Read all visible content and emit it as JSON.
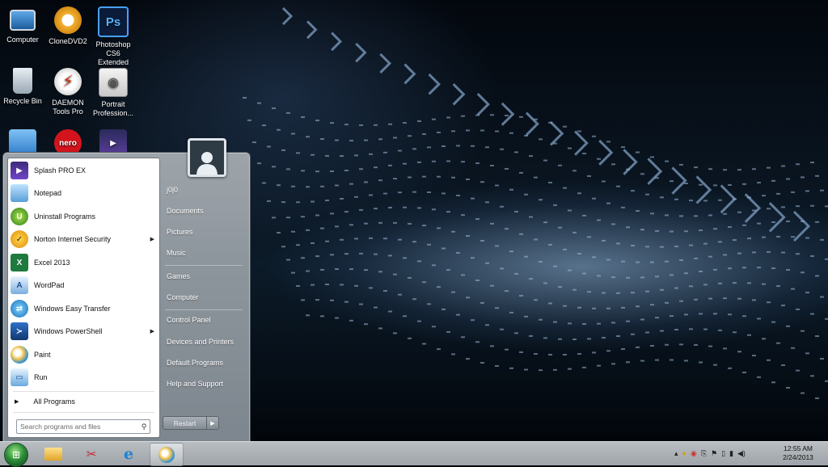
{
  "desktop": {
    "icons": [
      {
        "label": "Computer",
        "icon": "computer-icon"
      },
      {
        "label": "CloneDVD2",
        "icon": "clonedvd-sheep-icon"
      },
      {
        "label": "Photoshop CS6 Extended",
        "icon": "photoshop-icon",
        "glyph": "Ps"
      },
      {
        "label": "Recycle Bin",
        "icon": "recycle-bin-icon"
      },
      {
        "label": "DAEMON Tools Pro",
        "icon": "daemon-tools-icon"
      },
      {
        "label": "Portrait Profession...",
        "icon": "camera-icon"
      },
      {
        "label": "",
        "icon": "app-icon"
      },
      {
        "label": "",
        "icon": "nero-icon",
        "glyph": "nero"
      },
      {
        "label": "",
        "icon": "clapper-icon"
      }
    ]
  },
  "start_menu": {
    "programs": [
      {
        "label": "Splash PRO EX",
        "icon": "splash-pro-icon",
        "has_arrow": false
      },
      {
        "label": "Notepad",
        "icon": "notepad-icon",
        "has_arrow": false
      },
      {
        "label": "Uninstall Programs",
        "icon": "uninstall-icon",
        "has_arrow": false
      },
      {
        "label": "Norton Internet Security",
        "icon": "norton-icon",
        "has_arrow": true
      },
      {
        "label": "Excel 2013",
        "icon": "excel-icon",
        "has_arrow": false
      },
      {
        "label": "WordPad",
        "icon": "wordpad-icon",
        "has_arrow": false
      },
      {
        "label": "Windows Easy Transfer",
        "icon": "easy-transfer-icon",
        "has_arrow": false
      },
      {
        "label": "Windows PowerShell",
        "icon": "powershell-icon",
        "has_arrow": true
      },
      {
        "label": "Paint",
        "icon": "paint-icon",
        "has_arrow": false
      },
      {
        "label": "Run",
        "icon": "run-icon",
        "has_arrow": false
      }
    ],
    "all_programs": "All Programs",
    "search_placeholder": "Search programs and files",
    "user_name": "j0j0",
    "right_items": [
      "Documents",
      "Pictures",
      "Music",
      "Games",
      "Computer",
      "Control Panel",
      "Devices and Printers",
      "Default Programs",
      "Help and Support"
    ],
    "restart_label": "Restart"
  },
  "taskbar": {
    "pinned": [
      {
        "icon": "file-explorer-icon"
      },
      {
        "icon": "snipping-tool-icon"
      },
      {
        "icon": "internet-explorer-icon"
      },
      {
        "icon": "paint-icon",
        "active": true
      }
    ],
    "tray_icons": [
      "show-hidden-icon",
      "norton-tray-icon",
      "chrome-tray-icon",
      "usb-icon",
      "flag-icon",
      "battery-icon",
      "network-icon",
      "volume-icon"
    ],
    "clock_time": "12:55 AM",
    "clock_date": "2/24/2013"
  }
}
